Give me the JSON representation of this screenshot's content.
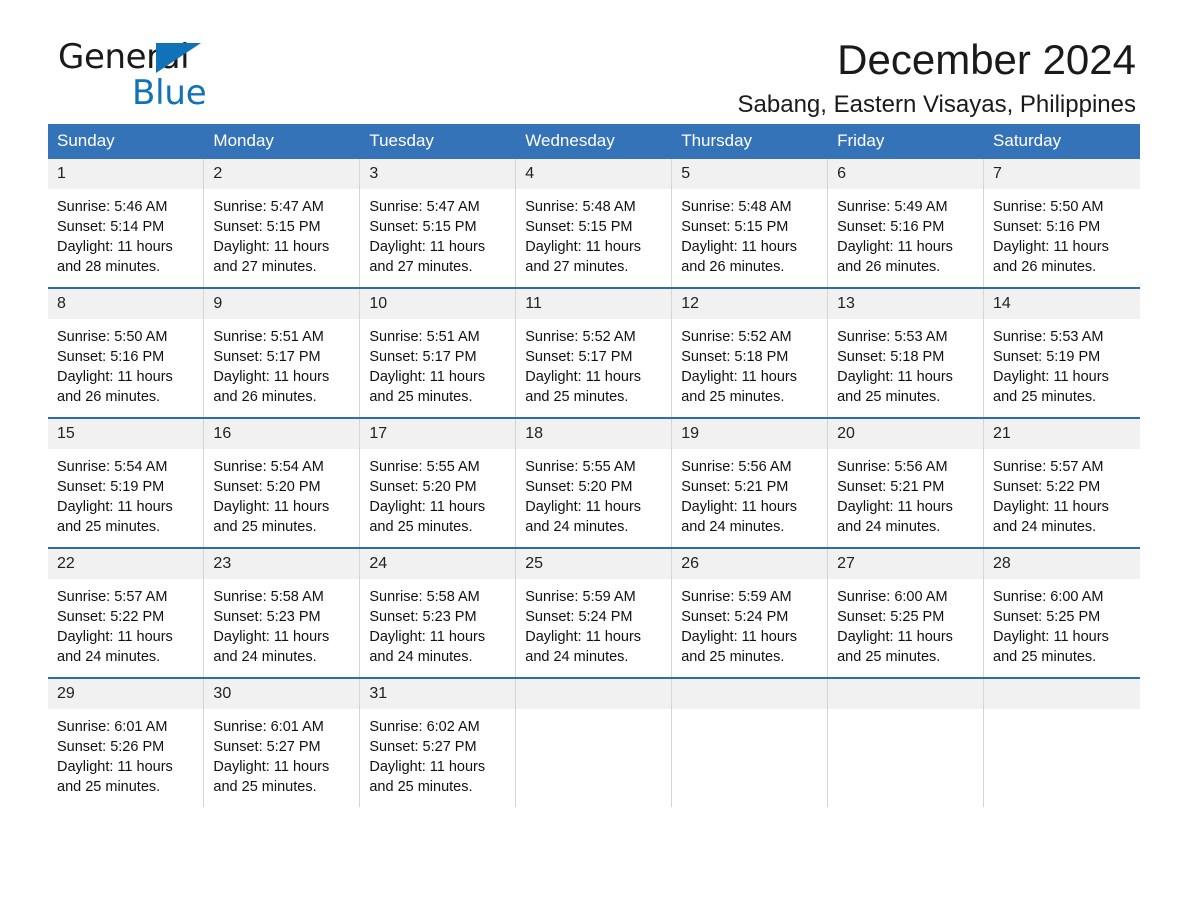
{
  "brand": {
    "name_part1": "General",
    "name_part2": "Blue",
    "accent_color": "#1172ba"
  },
  "header": {
    "title": "December 2024",
    "subtitle": "Sabang, Eastern Visayas, Philippines"
  },
  "calendar": {
    "header_bg": "#3573b9",
    "row_rule_color": "#2e6da9",
    "daynum_bg": "#f1f1f1",
    "weekdays": [
      "Sunday",
      "Monday",
      "Tuesday",
      "Wednesday",
      "Thursday",
      "Friday",
      "Saturday"
    ],
    "weeks": [
      [
        {
          "day": "1",
          "sunrise": "Sunrise: 5:46 AM",
          "sunset": "Sunset: 5:14 PM",
          "daylight_line1": "Daylight: 11 hours",
          "daylight_line2": "and 28 minutes."
        },
        {
          "day": "2",
          "sunrise": "Sunrise: 5:47 AM",
          "sunset": "Sunset: 5:15 PM",
          "daylight_line1": "Daylight: 11 hours",
          "daylight_line2": "and 27 minutes."
        },
        {
          "day": "3",
          "sunrise": "Sunrise: 5:47 AM",
          "sunset": "Sunset: 5:15 PM",
          "daylight_line1": "Daylight: 11 hours",
          "daylight_line2": "and 27 minutes."
        },
        {
          "day": "4",
          "sunrise": "Sunrise: 5:48 AM",
          "sunset": "Sunset: 5:15 PM",
          "daylight_line1": "Daylight: 11 hours",
          "daylight_line2": "and 27 minutes."
        },
        {
          "day": "5",
          "sunrise": "Sunrise: 5:48 AM",
          "sunset": "Sunset: 5:15 PM",
          "daylight_line1": "Daylight: 11 hours",
          "daylight_line2": "and 26 minutes."
        },
        {
          "day": "6",
          "sunrise": "Sunrise: 5:49 AM",
          "sunset": "Sunset: 5:16 PM",
          "daylight_line1": "Daylight: 11 hours",
          "daylight_line2": "and 26 minutes."
        },
        {
          "day": "7",
          "sunrise": "Sunrise: 5:50 AM",
          "sunset": "Sunset: 5:16 PM",
          "daylight_line1": "Daylight: 11 hours",
          "daylight_line2": "and 26 minutes."
        }
      ],
      [
        {
          "day": "8",
          "sunrise": "Sunrise: 5:50 AM",
          "sunset": "Sunset: 5:16 PM",
          "daylight_line1": "Daylight: 11 hours",
          "daylight_line2": "and 26 minutes."
        },
        {
          "day": "9",
          "sunrise": "Sunrise: 5:51 AM",
          "sunset": "Sunset: 5:17 PM",
          "daylight_line1": "Daylight: 11 hours",
          "daylight_line2": "and 26 minutes."
        },
        {
          "day": "10",
          "sunrise": "Sunrise: 5:51 AM",
          "sunset": "Sunset: 5:17 PM",
          "daylight_line1": "Daylight: 11 hours",
          "daylight_line2": "and 25 minutes."
        },
        {
          "day": "11",
          "sunrise": "Sunrise: 5:52 AM",
          "sunset": "Sunset: 5:17 PM",
          "daylight_line1": "Daylight: 11 hours",
          "daylight_line2": "and 25 minutes."
        },
        {
          "day": "12",
          "sunrise": "Sunrise: 5:52 AM",
          "sunset": "Sunset: 5:18 PM",
          "daylight_line1": "Daylight: 11 hours",
          "daylight_line2": "and 25 minutes."
        },
        {
          "day": "13",
          "sunrise": "Sunrise: 5:53 AM",
          "sunset": "Sunset: 5:18 PM",
          "daylight_line1": "Daylight: 11 hours",
          "daylight_line2": "and 25 minutes."
        },
        {
          "day": "14",
          "sunrise": "Sunrise: 5:53 AM",
          "sunset": "Sunset: 5:19 PM",
          "daylight_line1": "Daylight: 11 hours",
          "daylight_line2": "and 25 minutes."
        }
      ],
      [
        {
          "day": "15",
          "sunrise": "Sunrise: 5:54 AM",
          "sunset": "Sunset: 5:19 PM",
          "daylight_line1": "Daylight: 11 hours",
          "daylight_line2": "and 25 minutes."
        },
        {
          "day": "16",
          "sunrise": "Sunrise: 5:54 AM",
          "sunset": "Sunset: 5:20 PM",
          "daylight_line1": "Daylight: 11 hours",
          "daylight_line2": "and 25 minutes."
        },
        {
          "day": "17",
          "sunrise": "Sunrise: 5:55 AM",
          "sunset": "Sunset: 5:20 PM",
          "daylight_line1": "Daylight: 11 hours",
          "daylight_line2": "and 25 minutes."
        },
        {
          "day": "18",
          "sunrise": "Sunrise: 5:55 AM",
          "sunset": "Sunset: 5:20 PM",
          "daylight_line1": "Daylight: 11 hours",
          "daylight_line2": "and 24 minutes."
        },
        {
          "day": "19",
          "sunrise": "Sunrise: 5:56 AM",
          "sunset": "Sunset: 5:21 PM",
          "daylight_line1": "Daylight: 11 hours",
          "daylight_line2": "and 24 minutes."
        },
        {
          "day": "20",
          "sunrise": "Sunrise: 5:56 AM",
          "sunset": "Sunset: 5:21 PM",
          "daylight_line1": "Daylight: 11 hours",
          "daylight_line2": "and 24 minutes."
        },
        {
          "day": "21",
          "sunrise": "Sunrise: 5:57 AM",
          "sunset": "Sunset: 5:22 PM",
          "daylight_line1": "Daylight: 11 hours",
          "daylight_line2": "and 24 minutes."
        }
      ],
      [
        {
          "day": "22",
          "sunrise": "Sunrise: 5:57 AM",
          "sunset": "Sunset: 5:22 PM",
          "daylight_line1": "Daylight: 11 hours",
          "daylight_line2": "and 24 minutes."
        },
        {
          "day": "23",
          "sunrise": "Sunrise: 5:58 AM",
          "sunset": "Sunset: 5:23 PM",
          "daylight_line1": "Daylight: 11 hours",
          "daylight_line2": "and 24 minutes."
        },
        {
          "day": "24",
          "sunrise": "Sunrise: 5:58 AM",
          "sunset": "Sunset: 5:23 PM",
          "daylight_line1": "Daylight: 11 hours",
          "daylight_line2": "and 24 minutes."
        },
        {
          "day": "25",
          "sunrise": "Sunrise: 5:59 AM",
          "sunset": "Sunset: 5:24 PM",
          "daylight_line1": "Daylight: 11 hours",
          "daylight_line2": "and 24 minutes."
        },
        {
          "day": "26",
          "sunrise": "Sunrise: 5:59 AM",
          "sunset": "Sunset: 5:24 PM",
          "daylight_line1": "Daylight: 11 hours",
          "daylight_line2": "and 25 minutes."
        },
        {
          "day": "27",
          "sunrise": "Sunrise: 6:00 AM",
          "sunset": "Sunset: 5:25 PM",
          "daylight_line1": "Daylight: 11 hours",
          "daylight_line2": "and 25 minutes."
        },
        {
          "day": "28",
          "sunrise": "Sunrise: 6:00 AM",
          "sunset": "Sunset: 5:25 PM",
          "daylight_line1": "Daylight: 11 hours",
          "daylight_line2": "and 25 minutes."
        }
      ],
      [
        {
          "day": "29",
          "sunrise": "Sunrise: 6:01 AM",
          "sunset": "Sunset: 5:26 PM",
          "daylight_line1": "Daylight: 11 hours",
          "daylight_line2": "and 25 minutes."
        },
        {
          "day": "30",
          "sunrise": "Sunrise: 6:01 AM",
          "sunset": "Sunset: 5:27 PM",
          "daylight_line1": "Daylight: 11 hours",
          "daylight_line2": "and 25 minutes."
        },
        {
          "day": "31",
          "sunrise": "Sunrise: 6:02 AM",
          "sunset": "Sunset: 5:27 PM",
          "daylight_line1": "Daylight: 11 hours",
          "daylight_line2": "and 25 minutes."
        },
        {
          "day": "",
          "sunrise": "",
          "sunset": "",
          "daylight_line1": "",
          "daylight_line2": ""
        },
        {
          "day": "",
          "sunrise": "",
          "sunset": "",
          "daylight_line1": "",
          "daylight_line2": ""
        },
        {
          "day": "",
          "sunrise": "",
          "sunset": "",
          "daylight_line1": "",
          "daylight_line2": ""
        },
        {
          "day": "",
          "sunrise": "",
          "sunset": "",
          "daylight_line1": "",
          "daylight_line2": ""
        }
      ]
    ]
  }
}
